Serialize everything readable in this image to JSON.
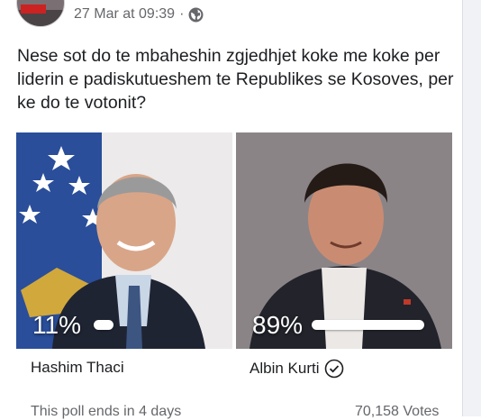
{
  "post": {
    "timestamp": "27 Mar at 09:39",
    "separator": "·",
    "privacy_icon": "globe-icon",
    "question": "Nese sot do te mbaheshin zgjedhjet koke me koke per liderin e padiskutueshem te Republikes se Kosoves, per ke do te votonit?"
  },
  "poll": {
    "options": [
      {
        "name": "Hashim Thaci",
        "percent_label": "11%",
        "share": 0.11,
        "selected": false
      },
      {
        "name": "Albin Kurti",
        "percent_label": "89%",
        "share": 0.89,
        "selected": true,
        "selected_icon": "check-circle-icon"
      }
    ],
    "footer_left": "This poll ends in 4 days",
    "footer_right": "70,158 Votes"
  },
  "colors": {
    "text": "#1c1e21",
    "muted": "#65676b",
    "bar": "#ffffff"
  }
}
